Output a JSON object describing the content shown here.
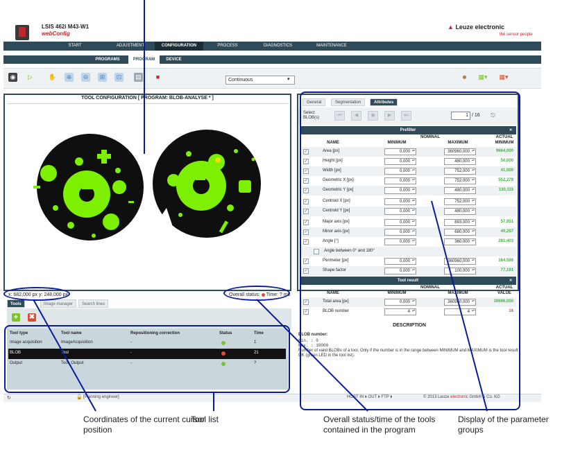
{
  "header": {
    "device": "LSIS 462i M43-W1",
    "app": "webConfig",
    "brand": "Leuze electronic",
    "slogan": "the sensor people"
  },
  "main_menu": [
    "START",
    "ADJUSTMENT",
    "CONFIGURATION",
    "PROCESS",
    "DIAGNOSTICS",
    "MAINTENANCE"
  ],
  "sub_menu": [
    "PROGRAMS",
    "PROGRAM",
    "DEVICE"
  ],
  "toolbar": {
    "mode": "Continuous"
  },
  "tool_config": {
    "title": "TOOL CONFIGURATION   [ PROGRAM: BLOB-ANALYSE * ]",
    "cursor": "x: 682,000 px y: 248,000 px",
    "status_label": "Overall status:",
    "time_label": "Time: ? ms"
  },
  "bottom_tabs": [
    "Tools",
    "Image manager",
    "Search lines"
  ],
  "tool_table": {
    "headers": [
      "Tool type",
      "Tool name",
      "Repositioning correction",
      "Status",
      "Time"
    ],
    "rows": [
      {
        "type": "Image acquisition",
        "name": "ImageAcquisition",
        "correction": "-",
        "status": "green",
        "time": "1"
      },
      {
        "type": "BLOB",
        "name": "Test",
        "correction": "-",
        "status": "red",
        "time": "21"
      },
      {
        "type": "Output",
        "name": "Tool_Output",
        "correction": "-",
        "status": "green",
        "time": "?"
      }
    ]
  },
  "statusbar": {
    "role": "[Planning engineer]",
    "io": "HOST IN ⏵  OUT ⏵  FTP ⏵",
    "copyright_a": "© 2013 Leuze ",
    "copyright_b": "electronic",
    "copyright_c": " GmbH & Co. KG"
  },
  "param_panel": {
    "tabs": [
      "General",
      "Segmentation",
      "Attributes"
    ],
    "select_label": "Select BLOB(s)",
    "blob_index": "1",
    "blob_total": "/ 16",
    "prefilter_title": "Prefilter",
    "col_name": "NAME",
    "col_nominal": "NOMINAL",
    "col_min": "MINIMUM",
    "col_max": "MAXIMUM",
    "col_actual_a": "ACTUAL",
    "col_actual_b": "MINIMUM",
    "prefilter": [
      {
        "name": "Area [px]",
        "min": "0,000",
        "max": "360960,000",
        "actual": "9664,000"
      },
      {
        "name": "Height [px]",
        "min": "0,000",
        "max": "480,000",
        "actual": "50,000"
      },
      {
        "name": "Width [px]",
        "min": "0,000",
        "max": "752,000",
        "actual": "41,000"
      },
      {
        "name": "Geometric X [px]",
        "min": "0,000",
        "max": "752,000",
        "actual": "552,278"
      },
      {
        "name": "Geometric Y [px]",
        "min": "0,000",
        "max": "480,000",
        "actual": "130,115"
      },
      {
        "name": "Centroid X [px]",
        "min": "0,000",
        "max": "752,000",
        "actual": ""
      },
      {
        "name": "Centroid Y [px]",
        "min": "0,000",
        "max": "480,000",
        "actual": ""
      },
      {
        "name": "Major axis [px]",
        "min": "0,000",
        "max": "893,000",
        "actual": "57,851"
      },
      {
        "name": "Minor axis [px]",
        "min": "0,000",
        "max": "680,000",
        "actual": "40,267"
      },
      {
        "name": "Angle [°]",
        "min": "0,000",
        "max": "360,000",
        "actual": "281,403"
      }
    ],
    "angle_option": "Angle between 0° and 180°",
    "prefilter_extra": [
      {
        "name": "Perimeter [px]",
        "min": "0,000",
        "max": "360960,000",
        "actual": "164,598"
      },
      {
        "name": "Shape factor",
        "min": "0,000",
        "max": "100,000",
        "actual": "77,191"
      }
    ],
    "result_title": "Tool result",
    "col_actual_c": "VALUE",
    "result": [
      {
        "name": "Total area [px]",
        "min": "0,000",
        "max": "360960,000",
        "actual": "30696,000",
        "color": "green"
      },
      {
        "name": "BLOB number",
        "min": "4",
        "max": "4",
        "actual": "16",
        "color": "red"
      }
    ]
  },
  "description": {
    "title": "DESCRIPTION",
    "heading": "BLOB number:",
    "min_line": "Min.  : 0",
    "max_line": "Max.  : 10000",
    "text": "Number of valid BLOBs of a tool. Only if the number is in the range between MINIMUM and MAXIMUM is the tool result OK (green LED in the tool list)."
  },
  "captions": {
    "coords": "Coordinates of the current cursor position",
    "tool_list": "Tool list",
    "overall": "Overall status/time of the tools contained in the program",
    "params": "Display of the parameter groups"
  },
  "colors": {
    "accent": "#2f4a58",
    "brand_red": "#c0272d",
    "ok_green": "#7cc42a",
    "error_red": "#e14b2a",
    "callout_blue": "#0a1aa0"
  }
}
